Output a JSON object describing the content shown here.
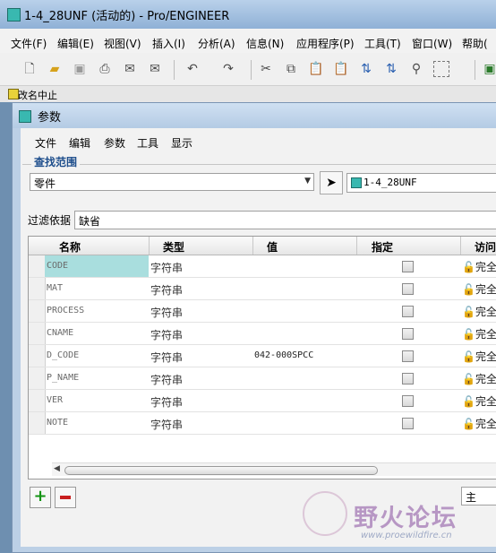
{
  "window": {
    "title": "1-4_28UNF (活动的) - Pro/ENGINEER"
  },
  "menu": [
    "文件(F)",
    "编辑(E)",
    "视图(V)",
    "插入(I)",
    "分析(A)",
    "信息(N)",
    "应用程序(P)",
    "工具(T)",
    "窗口(W)",
    "帮助("
  ],
  "status": {
    "text": "改名中止"
  },
  "dialog": {
    "title": "参数",
    "menu": [
      "文件",
      "编辑",
      "参数",
      "工具",
      "显示"
    ],
    "find_label": "查找范围",
    "scope_value": "零件",
    "model_value": "1-4_28UNF",
    "filter_label": "过滤依据",
    "filter_value": "缺省",
    "columns": [
      "名称",
      "类型",
      "值",
      "指定",
      "访问"
    ],
    "rows": [
      {
        "name": "CODE",
        "type": "字符串",
        "value": "",
        "access": "完全"
      },
      {
        "name": "MAT",
        "type": "字符串",
        "value": "",
        "access": "完全"
      },
      {
        "name": "PROCESS",
        "type": "字符串",
        "value": "",
        "access": "完全"
      },
      {
        "name": "CNAME",
        "type": "字符串",
        "value": "",
        "access": "完全"
      },
      {
        "name": "D_CODE",
        "type": "字符串",
        "value": "042-000SPCC",
        "access": "完全"
      },
      {
        "name": "P_NAME",
        "type": "字符串",
        "value": "",
        "access": "完全"
      },
      {
        "name": "VER",
        "type": "字符串",
        "value": "",
        "access": "完全"
      },
      {
        "name": "NOTE",
        "type": "字符串",
        "value": "",
        "access": "完全"
      }
    ],
    "main_field": "主"
  },
  "watermark": {
    "text": "野火论坛",
    "url": "www.proewildfire.cn"
  }
}
